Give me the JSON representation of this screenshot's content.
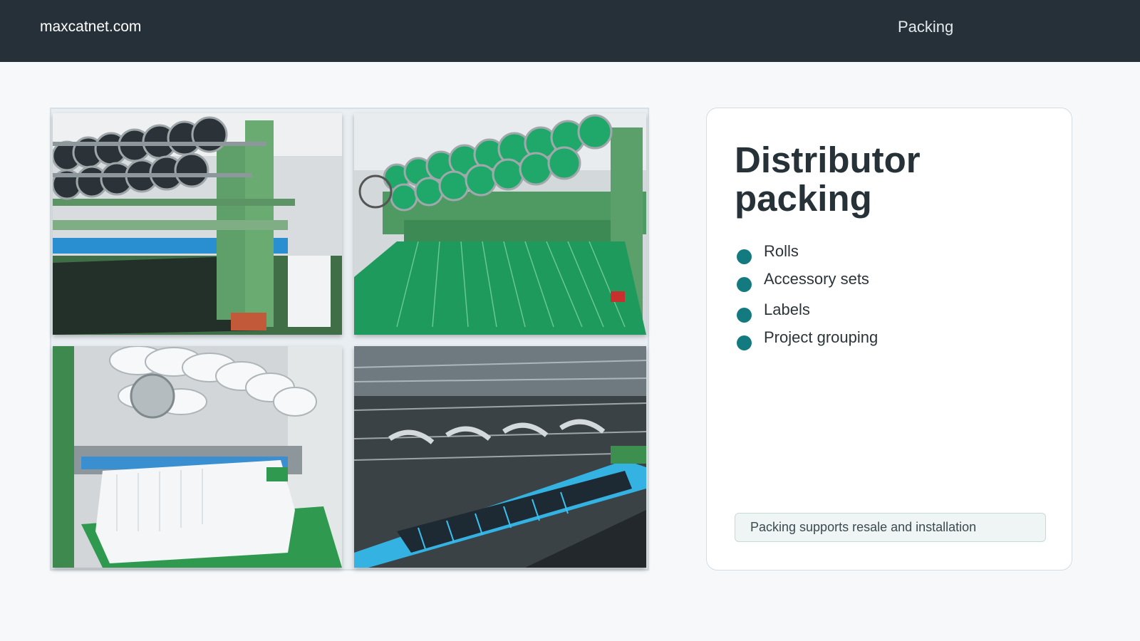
{
  "header": {
    "site_name": "maxcatnet.com",
    "section_label": "Packing"
  },
  "gallery": {
    "photos": [
      {
        "icon": "green-knitting-machine-black-yarn-photo"
      },
      {
        "icon": "green-knitting-machine-green-net-photo"
      },
      {
        "icon": "green-knitting-machine-white-net-photo"
      },
      {
        "icon": "knitting-machine-blue-net-closeup-photo"
      }
    ]
  },
  "card": {
    "title": "Distributor packing",
    "items": [
      {
        "label": "Rolls"
      },
      {
        "label": "Accessory sets"
      },
      {
        "label": "Labels"
      },
      {
        "label": "Project grouping"
      }
    ],
    "note": "Packing supports resale and installation"
  },
  "colors": {
    "header_bg": "#263038",
    "page_bg": "#f6f8fa",
    "accent": "#137a80",
    "note_bg": "#eef5f4"
  }
}
